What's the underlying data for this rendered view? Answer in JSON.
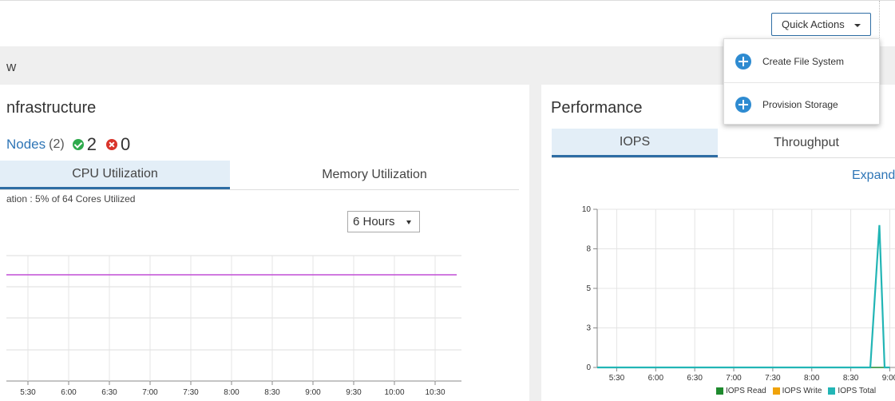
{
  "header": {
    "quick_actions_label": "Quick Actions"
  },
  "quick_actions_menu": [
    {
      "label": "Create File System",
      "icon": "plus-circle-icon"
    },
    {
      "label": "Provision Storage",
      "icon": "plus-circle-icon"
    }
  ],
  "page": {
    "title": "w"
  },
  "infrastructure": {
    "title": "nfrastructure",
    "nodes_link": "Nodes",
    "nodes_count": "(2)",
    "ok_count": "2",
    "error_count": "0",
    "tabs": [
      "CPU Utilization",
      "Memory Utilization"
    ],
    "active_tab": "CPU Utilization",
    "subtext": "ation : 5% of 64 Cores Utilized",
    "time_range": "6 Hours",
    "chart_data": {
      "type": "line",
      "x": [
        "5:30",
        "6:00",
        "6:30",
        "7:00",
        "7:30",
        "8:00",
        "8:30",
        "9:00",
        "9:30",
        "10:00",
        "10:30"
      ],
      "series": [
        {
          "color": "#c14fd6",
          "values": [
            5,
            5,
            5,
            5,
            5,
            5,
            5,
            5,
            5,
            5,
            5
          ]
        }
      ],
      "grid": true
    }
  },
  "performance": {
    "title": "Performance",
    "tabs": [
      "IOPS",
      "Throughput"
    ],
    "active_tab": "IOPS",
    "expand_label": "Expand",
    "chart_data": {
      "type": "line",
      "x": [
        "5:30",
        "6:00",
        "6:30",
        "7:00",
        "7:30",
        "8:00",
        "8:30",
        "9:00"
      ],
      "y_ticks": [
        "0",
        "3",
        "5",
        "8",
        "10"
      ],
      "ylim": [
        0,
        10
      ],
      "legend": [
        "IOPS Read",
        "IOPS Write",
        "IOPS Total"
      ],
      "legend_colors": [
        "#1f8a2e",
        "#f0a30a",
        "#22b5b5"
      ],
      "legend_position": "bottom",
      "series": [
        {
          "name": "IOPS Read",
          "color": "#1f8a2e",
          "x": [
            "5:15",
            "8:45",
            "8:52",
            "8:56",
            "9:00"
          ],
          "values": [
            0,
            0,
            0,
            0,
            0
          ]
        },
        {
          "name": "IOPS Total",
          "color": "#22b5b5",
          "x": [
            "5:15",
            "8:45",
            "8:52",
            "8:56",
            "9:00"
          ],
          "values": [
            0,
            0,
            9,
            0,
            0
          ]
        }
      ],
      "grid": true
    }
  }
}
